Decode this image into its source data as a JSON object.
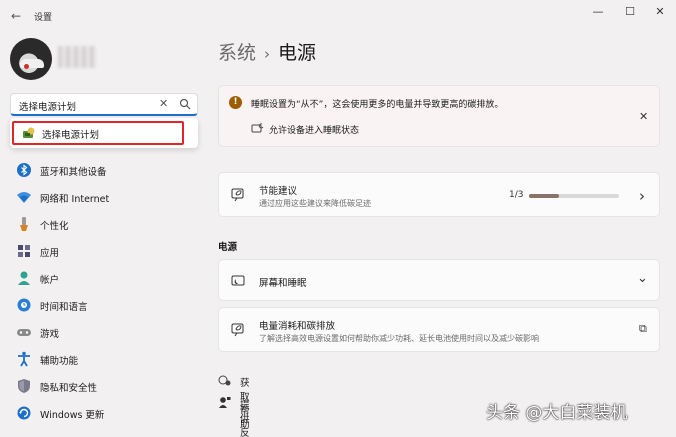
{
  "app": {
    "title": "设置"
  },
  "window_controls": {
    "minimize": "—",
    "maximize": "☐",
    "close": "✕"
  },
  "search": {
    "value": "选择电源计划",
    "clear": "✕"
  },
  "suggestion": {
    "label": "选择电源计划"
  },
  "sidebar": {
    "items": [
      {
        "label": "蓝牙和其他设备",
        "icon": "bluetooth-icon"
      },
      {
        "label": "网络和 Internet",
        "icon": "wifi-icon"
      },
      {
        "label": "个性化",
        "icon": "brush-icon"
      },
      {
        "label": "应用",
        "icon": "apps-icon"
      },
      {
        "label": "帐户",
        "icon": "account-icon"
      },
      {
        "label": "时间和语言",
        "icon": "globe-clock-icon"
      },
      {
        "label": "游戏",
        "icon": "gamepad-icon"
      },
      {
        "label": "辅助功能",
        "icon": "accessibility-icon"
      },
      {
        "label": "隐私和安全性",
        "icon": "shield-icon"
      },
      {
        "label": "Windows 更新",
        "icon": "update-icon"
      }
    ]
  },
  "breadcrumb": {
    "parent": "系统",
    "separator": "›",
    "current": "电源"
  },
  "warning": {
    "icon_text": "!",
    "text": "睡眠设置为“从不”，这会使用更多的电量并导致更高的碳排放。",
    "link": "允许设备进入睡眠状态",
    "close": "✕"
  },
  "energy": {
    "title": "节能建议",
    "subtitle": "通过应用这些建议来降低碳足迹",
    "progress_text": "1/3",
    "progress_fraction": 0.33,
    "chevron": "›"
  },
  "power_section": {
    "title": "电源"
  },
  "screen_sleep": {
    "title": "屏幕和睡眠",
    "chevron": "⌄"
  },
  "power_usage": {
    "title": "电量消耗和碳排放",
    "subtitle": "了解选择高效电源设置如何帮助你减少功耗、延长电池使用时间以及减少碳影响",
    "link_icon": "⧉"
  },
  "help": {
    "get_help": "获取帮助",
    "feedback": "提供反馈"
  },
  "watermark": "头条 @大白菜装机",
  "colors": {
    "accent": "#1e6fc8",
    "highlight_border": "#e0262b",
    "warning_icon": "#9d5d00"
  }
}
